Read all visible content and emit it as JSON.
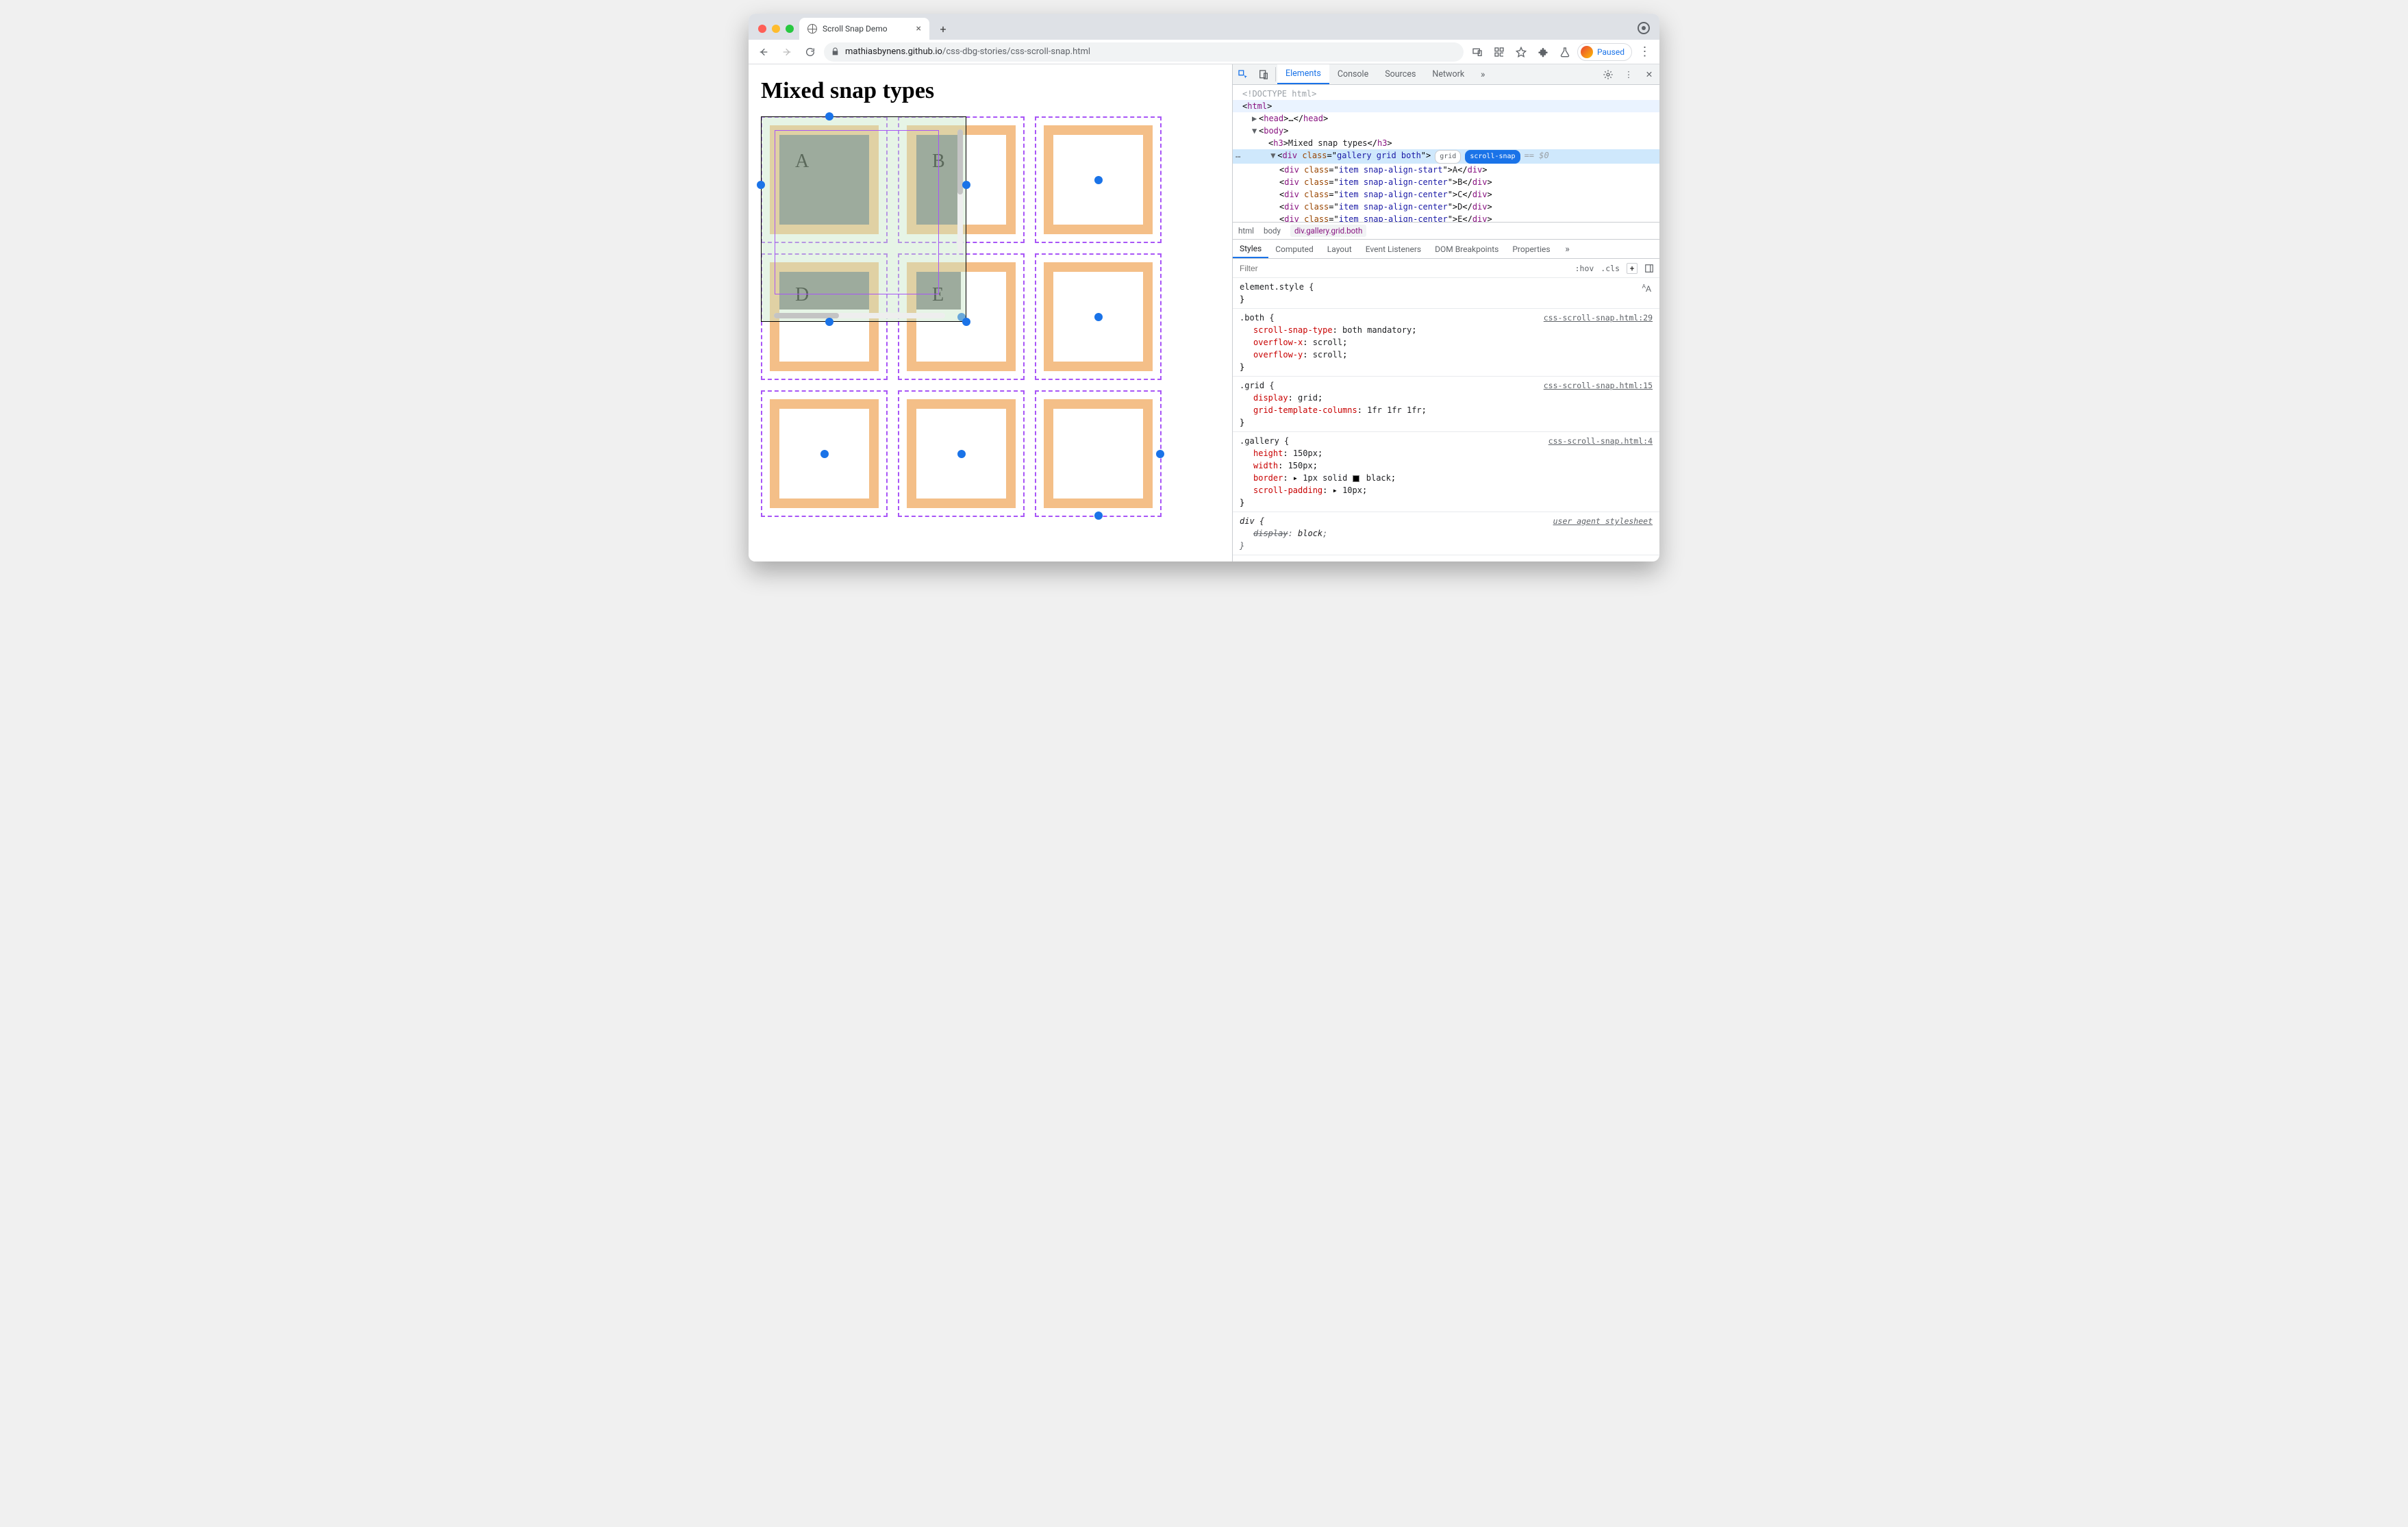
{
  "browser": {
    "tab_title": "Scroll Snap Demo",
    "url_host": "mathiasbynens.github.io",
    "url_path": "/css-dbg-stories/css-scroll-snap.html",
    "paused_label": "Paused"
  },
  "page": {
    "heading": "Mixed snap types",
    "items": [
      "A",
      "B",
      "D",
      "E"
    ]
  },
  "devtools": {
    "main_tabs": [
      "Elements",
      "Console",
      "Sources",
      "Network"
    ],
    "active_main_tab": "Elements",
    "tree": {
      "doctype": "<!DOCTYPE html>",
      "nodes": [
        {
          "indent": 0,
          "open": "html",
          "expand": "open"
        },
        {
          "indent": 1,
          "open": "head",
          "collapsed": true,
          "close": "head"
        },
        {
          "indent": 1,
          "open": "body",
          "expand": "open"
        },
        {
          "indent": 2,
          "open": "h3",
          "text": "Mixed snap types",
          "close": "h3"
        }
      ],
      "selected": {
        "indent": 2,
        "tag": "div",
        "class_attr": "gallery grid both",
        "badges": [
          "grid",
          "scroll-snap"
        ],
        "count": "== $0"
      },
      "children": [
        {
          "tag": "div",
          "class_attr": "item snap-align-start",
          "text": "A"
        },
        {
          "tag": "div",
          "class_attr": "item snap-align-center",
          "text": "B"
        },
        {
          "tag": "div",
          "class_attr": "item snap-align-center",
          "text": "C"
        },
        {
          "tag": "div",
          "class_attr": "item snap-align-center",
          "text": "D"
        },
        {
          "tag": "div",
          "class_attr": "item snap-align-center",
          "text": "E"
        }
      ]
    },
    "breadcrumb": [
      "html",
      "body",
      "div.gallery.grid.both"
    ],
    "styles_tabs": [
      "Styles",
      "Computed",
      "Layout",
      "Event Listeners",
      "DOM Breakpoints",
      "Properties"
    ],
    "active_styles_tab": "Styles",
    "filter_placeholder": "Filter",
    "filter_opts": [
      ":hov",
      ".cls"
    ],
    "rules": [
      {
        "selector": "element.style",
        "props": []
      },
      {
        "selector": ".both",
        "source": "css-scroll-snap.html:29",
        "props": [
          {
            "name": "scroll-snap-type",
            "value": "both mandatory"
          },
          {
            "name": "overflow-x",
            "value": "scroll"
          },
          {
            "name": "overflow-y",
            "value": "scroll"
          }
        ]
      },
      {
        "selector": ".grid",
        "source": "css-scroll-snap.html:15",
        "props": [
          {
            "name": "display",
            "value": "grid"
          },
          {
            "name": "grid-template-columns",
            "value": "1fr 1fr 1fr"
          }
        ]
      },
      {
        "selector": ".gallery",
        "source": "css-scroll-snap.html:4",
        "props": [
          {
            "name": "height",
            "value": "150px"
          },
          {
            "name": "width",
            "value": "150px"
          },
          {
            "name": "border",
            "value": "1px solid ■ black",
            "swatch": true,
            "expand": true
          },
          {
            "name": "scroll-padding",
            "value": "10px",
            "expand": true
          }
        ]
      },
      {
        "selector": "div",
        "source": "user agent stylesheet",
        "ua": true,
        "props": [
          {
            "name": "display",
            "value": "block"
          }
        ]
      }
    ]
  },
  "chart_data": null
}
